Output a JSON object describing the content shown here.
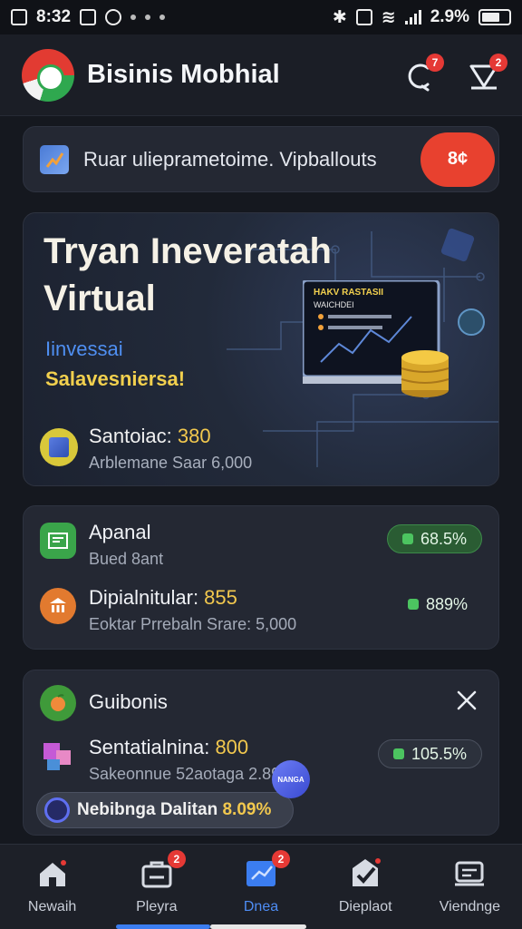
{
  "status_bar": {
    "time": "8:32",
    "battery": "2.9%"
  },
  "header": {
    "title": "Bisinis Mobhial",
    "notification_count": "7",
    "chat_count": "2"
  },
  "notice": {
    "text": "Ruar ulieprametoime. Vipballouts",
    "button_label": "8¢"
  },
  "hero": {
    "title_line1": "Tryan Ineveratah",
    "title_line2": "Virtual",
    "sub1": "Iinvessai",
    "sub2": "Salavesniersa!",
    "stat_label": "Santoiac: ",
    "stat_value": "380",
    "stat_sub": "Arblemane Saar 6,000",
    "laptop_heading": "HAKV RASTASII",
    "laptop_sub": "WAICHDEI"
  },
  "stats": {
    "row1": {
      "title": "Apanal",
      "sub": "Bued 8ant",
      "pill": "68.5%"
    },
    "row2": {
      "title": "Dipialnitular: ",
      "value": "855",
      "sub": "Eoktar Prrebaln Srare: 5,000",
      "pill": "889%"
    }
  },
  "bonus": {
    "title": "Guibonis",
    "row_title": "Sentatialnina: ",
    "row_value": "800",
    "row_sub": "Sakeonnue 52aotaga 2.89",
    "pill": "105.5%"
  },
  "floating": {
    "text": "Nebibnga Dalitan ",
    "value": "8.09%",
    "bubble_text": "NANGA"
  },
  "nav": {
    "items": [
      {
        "label": "Newaih",
        "badge": ""
      },
      {
        "label": "Pleyra",
        "badge": "2"
      },
      {
        "label": "Dnea",
        "badge": "2"
      },
      {
        "label": "Dieplaot",
        "badge": ""
      },
      {
        "label": "Viendnge",
        "badge": ""
      }
    ],
    "active_index": 2
  },
  "colors": {
    "accent": "#e8412f",
    "highlight": "#f2c84e",
    "active_blue": "#4e8df5",
    "positive_green": "#4cc460"
  }
}
